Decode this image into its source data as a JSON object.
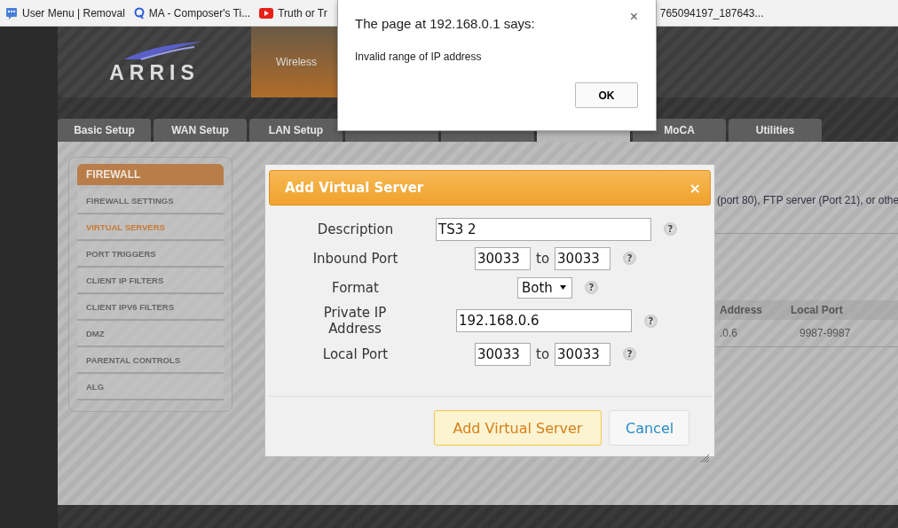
{
  "bookmarks": [
    {
      "label": "User Menu | Removal",
      "kind": "chat"
    },
    {
      "label": "MA - Composer's Ti...",
      "kind": "q"
    },
    {
      "label": "Truth or Tr",
      "kind": "video"
    },
    {
      "label": "765094197_187643...",
      "kind": "none"
    }
  ],
  "header": {
    "logo": "ARRIS",
    "tabs": [
      {
        "label": "Wireless",
        "selected": true
      }
    ]
  },
  "tabs": [
    {
      "label": "Basic Setup",
      "selected": false
    },
    {
      "label": "WAN Setup",
      "selected": false
    },
    {
      "label": "LAN Setup",
      "selected": false
    },
    {
      "selected": false
    },
    {
      "selected": false
    },
    {
      "selected": true
    },
    {
      "label": "MoCA",
      "selected": false
    },
    {
      "label": "Utilities",
      "selected": false
    }
  ],
  "sidebar": {
    "title": "FIREWALL",
    "items": [
      {
        "label": "FIREWALL SETTINGS",
        "selected": false
      },
      {
        "label": "VIRTUAL SERVERS",
        "selected": true
      },
      {
        "label": "PORT TRIGGERS",
        "selected": false
      },
      {
        "label": "CLIENT IP FILTERS",
        "selected": false
      },
      {
        "label": "CLIENT IPV6 FILTERS",
        "selected": false
      },
      {
        "label": "DMZ",
        "selected": false
      },
      {
        "label": "PARENTAL CONTROLS",
        "selected": false
      },
      {
        "label": "ALG",
        "selected": false
      }
    ]
  },
  "content": {
    "description": "(port 80), FTP server (Port 21), or othe",
    "table": {
      "columns": [
        "Address",
        "Local Port"
      ],
      "rows": [
        [
          ".0.6",
          "9987-9987"
        ]
      ]
    }
  },
  "modal": {
    "title": "Add Virtual Server",
    "close": "×",
    "fields": [
      {
        "kind": "text",
        "label": "Description",
        "value": "TS3 2",
        "help": "?"
      },
      {
        "kind": "range",
        "label": "Inbound Port",
        "from": "30033",
        "to_label": "to",
        "to": "30033",
        "help": "?"
      },
      {
        "kind": "select",
        "label": "Format",
        "value": "Both",
        "help": "?"
      },
      {
        "kind": "ip",
        "label": "Private IP Address",
        "value": "192.168.0.6",
        "help": "?"
      },
      {
        "kind": "range",
        "label": "Local Port",
        "from": "30033",
        "to_label": "to",
        "to": "30033",
        "help": "?"
      }
    ],
    "buttons": [
      {
        "label": "Add Virtual Server",
        "kind": "primary"
      },
      {
        "label": "Cancel",
        "kind": "secondary"
      }
    ]
  },
  "alert": {
    "title": "The page at 192.168.0.1 says:",
    "message": "Invalid range of IP address",
    "close": "×",
    "button": "OK"
  }
}
